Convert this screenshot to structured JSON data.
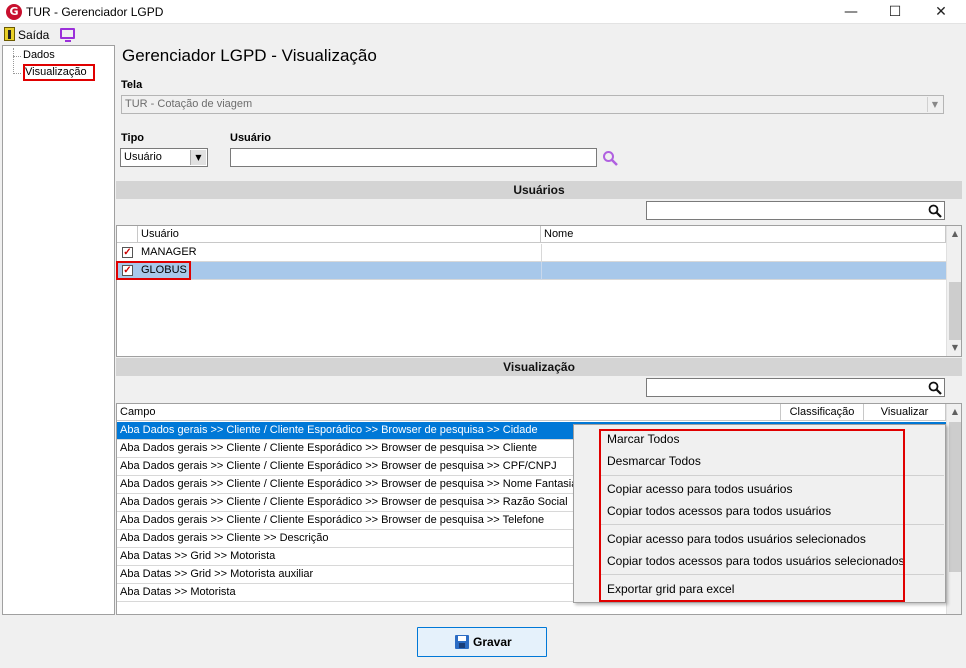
{
  "window": {
    "logo_letter": "G",
    "title": "TUR - Gerenciador LGPD",
    "minimize": "—",
    "maximize": "☐",
    "close": "✕"
  },
  "menu": {
    "exit_label": "Saída"
  },
  "tree": {
    "items": [
      "Dados",
      "Visualização"
    ]
  },
  "page": {
    "title": "Gerenciador LGPD - Visualização"
  },
  "tela": {
    "label": "Tela",
    "value": "TUR - Cotação de viagem"
  },
  "tipo": {
    "label": "Tipo",
    "value": "Usuário"
  },
  "usuario_field": {
    "label": "Usuário",
    "value": ""
  },
  "usuarios_section": {
    "title": "Usuários",
    "columns": [
      "Usuário",
      "Nome"
    ],
    "rows": [
      {
        "usuario": "MANAGER",
        "nome": "",
        "checked": "✓"
      },
      {
        "usuario": "GLOBUS",
        "nome": "",
        "checked": "✓"
      }
    ]
  },
  "visualizacao_section": {
    "title": "Visualização",
    "columns": [
      "Campo",
      "Classificação",
      "Visualizar"
    ],
    "rows": [
      "Aba Dados gerais >> Cliente / Cliente Esporádico >> Browser de pesquisa >> Cidade",
      "Aba Dados gerais >> Cliente / Cliente Esporádico >> Browser de pesquisa >> Cliente",
      "Aba Dados gerais >> Cliente / Cliente Esporádico >> Browser de pesquisa >> CPF/CNPJ",
      "Aba Dados gerais >> Cliente / Cliente Esporádico >> Browser de pesquisa >> Nome Fantasia",
      "Aba Dados gerais >> Cliente / Cliente Esporádico >> Browser de pesquisa >> Razão Social",
      "Aba Dados gerais >> Cliente / Cliente Esporádico >> Browser de pesquisa >> Telefone",
      "Aba Dados gerais >> Cliente >> Descrição",
      "Aba Datas >> Grid >> Motorista",
      "Aba Datas >> Grid >> Motorista auxiliar",
      "Aba Datas >> Motorista"
    ]
  },
  "context_menu": {
    "items": [
      "Marcar Todos",
      "Desmarcar Todos",
      "Copiar acesso para todos usuários",
      "Copiar todos acessos para todos usuários",
      "Copiar acesso para todos usuários selecionados",
      "Copiar todos acessos para todos usuários selecionados",
      "Exportar grid para excel"
    ]
  },
  "save_button": {
    "label": "Gravar"
  },
  "colors": {
    "accent": "#0078d7",
    "highlight_red": "#e00000",
    "icon_purple": "#9b30d9"
  }
}
